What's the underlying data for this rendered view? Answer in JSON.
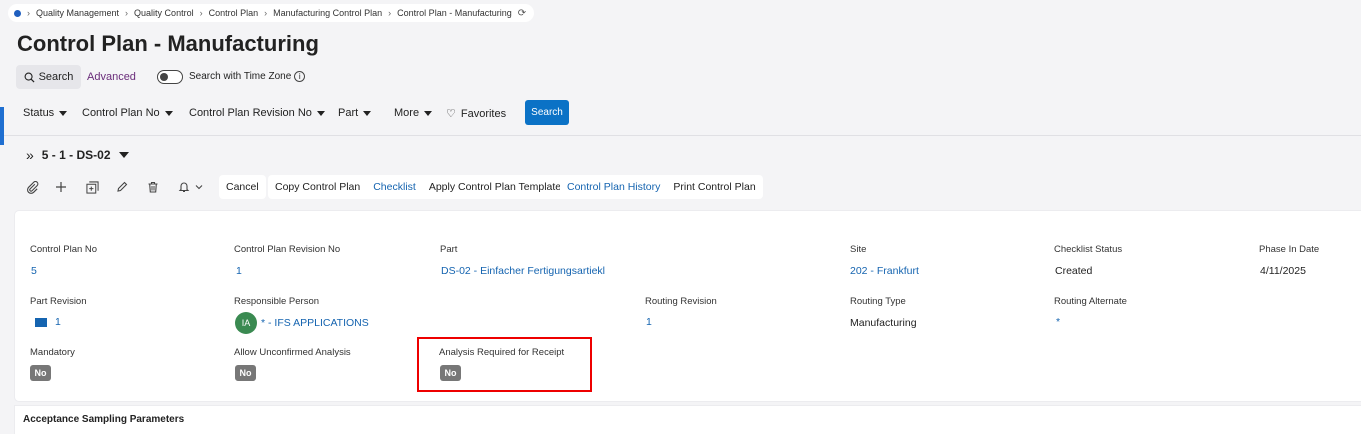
{
  "breadcrumb": {
    "items": [
      "Quality Management",
      "Quality Control",
      "Control Plan",
      "Manufacturing Control Plan",
      "Control Plan - Manufacturing"
    ]
  },
  "page": {
    "title": "Control Plan - Manufacturing"
  },
  "search": {
    "button_label": "Search",
    "advanced_label": "Advanced",
    "timezone_label": "Search with Time Zone",
    "timezone_enabled": false
  },
  "filters": {
    "items": [
      "Status",
      "Control Plan No",
      "Control Plan Revision No",
      "Part",
      "More"
    ],
    "favorites_label": "Favorites",
    "search_label": "Search"
  },
  "record": {
    "selector": "5 - 1 - DS-02"
  },
  "toolbar": {
    "icons": [
      "paperclip-icon",
      "add-icon",
      "duplicate-icon",
      "edit-icon",
      "delete-icon",
      "bell-icon"
    ],
    "cancel_label": "Cancel",
    "group1": [
      "Copy Control Plan",
      "Checklist",
      "Apply Control Plan Template"
    ],
    "group2": [
      "Control Plan History",
      "Print Control Plan"
    ]
  },
  "fields": {
    "control_plan_no": {
      "label": "Control Plan No",
      "value": "5"
    },
    "control_plan_revision_no": {
      "label": "Control Plan Revision No",
      "value": "1"
    },
    "part": {
      "label": "Part",
      "value": "DS-02 - Einfacher Fertigungsartiekl"
    },
    "site": {
      "label": "Site",
      "value": "202 - Frankfurt"
    },
    "checklist_status": {
      "label": "Checklist Status",
      "value": "Created"
    },
    "phase_in_date": {
      "label": "Phase In Date",
      "value": "4/11/2025"
    },
    "part_revision": {
      "label": "Part Revision",
      "value": "1"
    },
    "responsible_person": {
      "label": "Responsible Person",
      "initials": "IA",
      "value": "* - IFS APPLICATIONS"
    },
    "routing_revision": {
      "label": "Routing Revision",
      "value": "1"
    },
    "routing_type": {
      "label": "Routing Type",
      "value": "Manufacturing"
    },
    "routing_alternate": {
      "label": "Routing Alternate",
      "value": "*"
    },
    "mandatory": {
      "label": "Mandatory",
      "value": "No"
    },
    "allow_unconfirmed_analysis": {
      "label": "Allow Unconfirmed Analysis",
      "value": "No"
    },
    "analysis_required_for_receipt": {
      "label": "Analysis Required for Receipt",
      "value": "No"
    }
  },
  "sections": {
    "acceptance_sampling": "Acceptance Sampling Parameters"
  },
  "colors": {
    "primary": "#0b72c6",
    "link": "#1564b0",
    "highlight": "#e00000",
    "avatar": "#3a8a51"
  }
}
